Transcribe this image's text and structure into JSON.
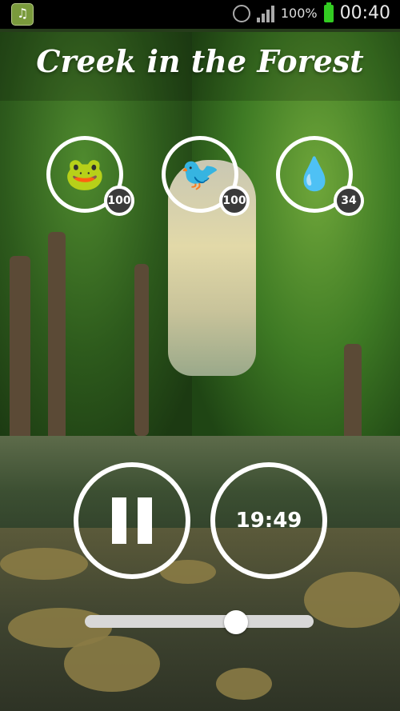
{
  "status_bar": {
    "app_icon": "music-note-icon",
    "alarm_icon": "alarm-clock-icon",
    "signal_icon": "signal-strength-icon",
    "battery_percent": "100%",
    "battery_icon": "battery-full-icon",
    "battery_color": "#33cc22",
    "time": "00:40"
  },
  "title": "Creek in the Forest",
  "sounds": [
    {
      "name": "frog",
      "icon": "frog-icon",
      "glyph": "🐸",
      "volume": "100"
    },
    {
      "name": "woodpecker",
      "icon": "woodpecker-icon",
      "glyph": "🐦",
      "volume": "100"
    },
    {
      "name": "water-drops",
      "icon": "water-drops-icon",
      "glyph": "💧",
      "volume": "34"
    }
  ],
  "playback": {
    "pause_icon": "pause-icon",
    "timer": "19:49"
  },
  "volume_slider": {
    "value_fraction": 0.66
  }
}
